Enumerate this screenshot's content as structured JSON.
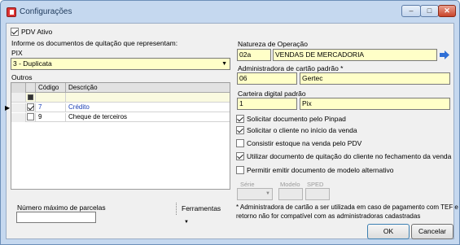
{
  "window": {
    "title": "Configurações",
    "minimize": "–",
    "maximize": "□",
    "close": "✕"
  },
  "left": {
    "pdv_ativo_label": "PDV Ativo",
    "pdv_ativo_checked": true,
    "informe_label": "Informe os documentos de quitação que representam:",
    "pix_label": "PIX",
    "pix_value": "3 - Duplicata",
    "outros_label": "Outros",
    "grid": {
      "headers": [
        "Código",
        "Descrição"
      ],
      "rows": [
        {
          "checked": true,
          "codigo": "7",
          "descricao": "Crédito",
          "current": true
        },
        {
          "checked": false,
          "codigo": "9",
          "descricao": "Cheque de terceiros",
          "current": false
        }
      ]
    },
    "max_parcelas_label": "Número máximo de parcelas",
    "max_parcelas_value": "",
    "ferramentas_label": "Ferramentas"
  },
  "right": {
    "natureza_label": "Natureza de Operação",
    "natureza_code": "02a",
    "natureza_desc": "VENDAS DE MERCADORIA",
    "admin_label": "Administradora de cartão padrão *",
    "admin_code": "06",
    "admin_desc": "Gertec",
    "carteira_label": "Carteira digital padrão",
    "carteira_code": "1",
    "carteira_desc": "Pix",
    "options": [
      {
        "label": "Solicitar documento pelo Pinpad",
        "checked": true
      },
      {
        "label": "Solicitar o cliente no início da venda",
        "checked": true
      },
      {
        "label": "Consistir estoque na venda pelo PDV",
        "checked": false
      },
      {
        "label": "Utilizar documento de quitação do cliente no fechamento da venda",
        "checked": true
      },
      {
        "label": "Permitir emitir documento de modelo alternativo",
        "checked": false
      }
    ],
    "serie_label": "Série",
    "modelo_label": "Modelo",
    "sped_label": "SPED",
    "footnote_line1": "* Administradora de cartão a ser utilizada em caso de pagamento com TEF e o",
    "footnote_line2": "retorno não for compatível com as administradoras cadastradas"
  },
  "buttons": {
    "ok": "OK",
    "cancel": "Cancelar"
  }
}
